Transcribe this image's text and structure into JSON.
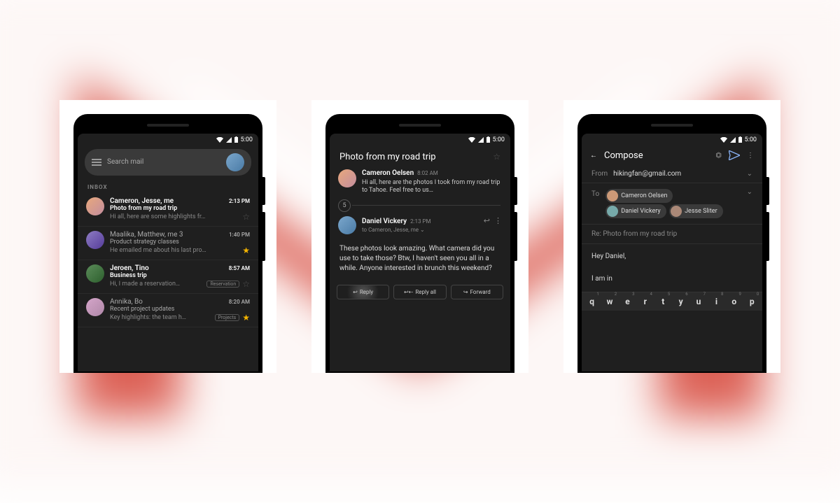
{
  "status": {
    "time": "5:00"
  },
  "screen1": {
    "search_placeholder": "Search mail",
    "section_label": "INBOX",
    "rows": [
      {
        "from": "Cameron, Jesse, me",
        "time": "2:13 PM",
        "subject": "Photo from my road trip",
        "preview": "Hi all, here are some highlights fr…",
        "starred": false,
        "unread": true,
        "count": ""
      },
      {
        "from": "Maalika, Matthew, me",
        "count": "3",
        "time": "1:40 PM",
        "subject": "Product strategy classes",
        "preview": "He emailed me about his last pro…",
        "starred": true,
        "unread": false
      },
      {
        "from": "Jeroen, Tino",
        "time": "8:57 AM",
        "subject": "Business trip",
        "preview": "Hi, I made a reservation…",
        "chip": "Reservation",
        "starred": false,
        "unread": true
      },
      {
        "from": "Annika, Bo",
        "time": "8:20 AM",
        "subject": "Recent project updates",
        "preview": "Key highlights: the team h…",
        "chip": "Projects",
        "starred": true,
        "unread": false
      }
    ]
  },
  "screen2": {
    "title": "Photo from my road trip",
    "collapsed_count": "5",
    "msg1": {
      "from": "Cameron Oelsen",
      "time": "8:02 AM",
      "snippet": "Hi all, here are the photos I took from my road trip to Tahoe. Feel free to us…"
    },
    "msg2": {
      "from": "Daniel Vickery",
      "time": "2:13 PM",
      "to": "to Cameron, Jesse, me",
      "body": "These photos look amazing. What camera did you use to take those? Btw, I haven't seen you all in a while. Anyone interested in brunch this weekend?"
    },
    "actions": {
      "reply": "Reply",
      "reply_all": "Reply all",
      "forward": "Forward"
    }
  },
  "screen3": {
    "title": "Compose",
    "from_label": "From",
    "from_value": "hikingfan@gmail.com",
    "to_label": "To",
    "recipients": [
      "Cameron Oelsen",
      "Daniel Vickery",
      "Jesse Sliter"
    ],
    "subject": "Re: Photo from my road trip",
    "body_line1": "Hey Daniel,",
    "body_line2": "I am in",
    "keyboard": [
      "q",
      "w",
      "e",
      "r",
      "t",
      "y",
      "u",
      "i",
      "o",
      "p"
    ]
  }
}
